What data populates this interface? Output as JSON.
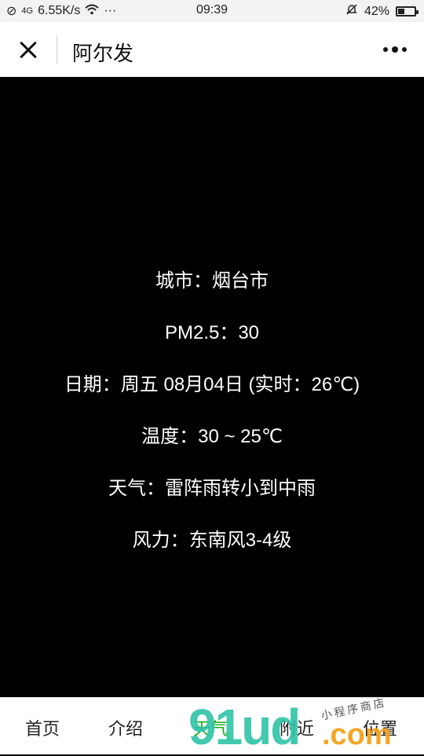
{
  "status_bar": {
    "network_type": "4G",
    "speed": "6.55K/s",
    "more": "···",
    "time": "09:39",
    "battery": "42%",
    "battery_level": 0.42
  },
  "header": {
    "title": "阿尔发"
  },
  "weather": {
    "city": "城市：烟台市",
    "pm25": "PM2.5：30",
    "date": "日期：周五 08月04日 (实时：26℃)",
    "temperature": "温度：30 ~ 25℃",
    "condition": "天气：雷阵雨转小到中雨",
    "wind": "风力：东南风3-4级"
  },
  "tabbar": {
    "tabs": [
      {
        "label": "首页"
      },
      {
        "label": "介绍"
      },
      {
        "label": "天气",
        "active": true
      },
      {
        "label": "附近"
      },
      {
        "label": "位置"
      }
    ],
    "active_color": "#1aad19"
  },
  "watermark": {
    "brand": "91ud",
    "domain": ".com",
    "tagline": "小程序商店"
  }
}
